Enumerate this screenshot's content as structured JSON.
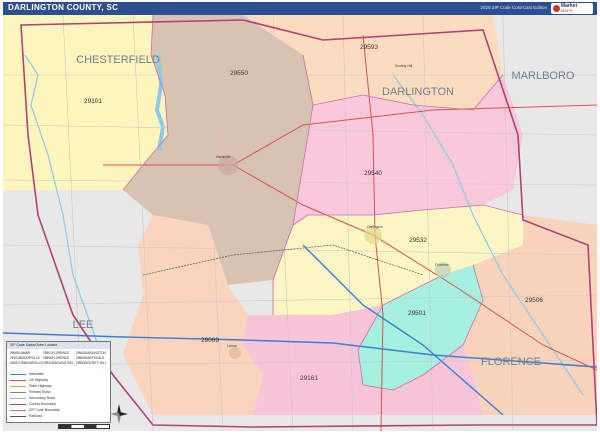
{
  "header": {
    "title": "DARLINGTON COUNTY, SC",
    "edition": "2020 ZIP Code ColorCast Edition",
    "logo_line1": "Market",
    "logo_line2": "MAPS"
  },
  "map": {
    "county_labels": [
      "CHESTERFIELD",
      "MARLBORO",
      "DARLINGTON",
      "LEE",
      "FLORENCE"
    ],
    "zip_zones": [
      {
        "zip": "29101",
        "color": "#fdf6bc"
      },
      {
        "zip": "29550",
        "color": "#d8c2b2"
      },
      {
        "zip": "29593",
        "color": "#fbdcc0"
      },
      {
        "zip": "29540",
        "color": "#f9c8da"
      },
      {
        "zip": "29532",
        "color": "#fcf6c4"
      },
      {
        "zip": "29506",
        "color": "#fad3bc"
      },
      {
        "zip": "29501",
        "color": "#a6f0e0"
      },
      {
        "zip": "29069",
        "color": "#fad4bc"
      },
      {
        "zip": "29161",
        "color": "#f8c4d8"
      }
    ],
    "city_labels": [
      "Society Hill",
      "Hartsville",
      "Darlington",
      "Lamar",
      "Florence"
    ],
    "colors": {
      "outside": "#e8e8e8",
      "county_line": "#b3407a",
      "road_main": "#d9534f",
      "interstate": "#3b7dd8",
      "water": "#8fc9e8"
    }
  },
  "legend": {
    "title": "ZIP Code Sales/Order Locator",
    "zip_table": [
      "29069",
      "29101",
      "29161",
      "29501",
      "29506",
      "29532",
      "29540",
      "29550",
      "29593"
    ],
    "zip_places": [
      "LAMAR",
      "BISHOPVILLE",
      "TIMMONSVILLE",
      "FLORENCE",
      "FLORENCE",
      "DARLINGTON",
      "DARLINGTON",
      "HARTSVILLE",
      "SOCIETY HILL"
    ],
    "items": [
      {
        "label": "Interstate",
        "color": "#3b7dd8"
      },
      {
        "label": "US Highway",
        "color": "#d9534f"
      },
      {
        "label": "State Highway",
        "color": "#e89b4a"
      },
      {
        "label": "Primary Road",
        "color": "#888888"
      },
      {
        "label": "Secondary Road",
        "color": "#aaaaaa"
      },
      {
        "label": "County Boundary",
        "color": "#b3407a"
      },
      {
        "label": "ZIP Code Boundary",
        "color": "#c86fa8"
      },
      {
        "label": "Railroad",
        "color": "#555555"
      }
    ]
  }
}
